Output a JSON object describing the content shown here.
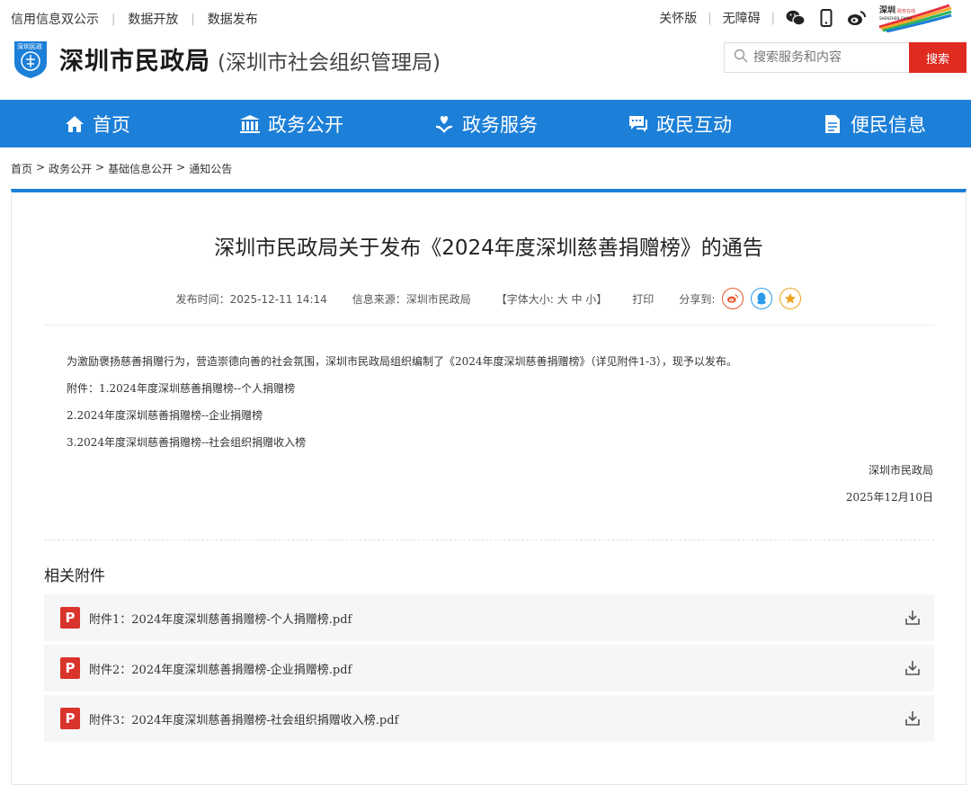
{
  "topbar": {
    "links": [
      "信用信息双公示",
      "数据开放",
      "数据发布"
    ],
    "care_mode": "关怀版",
    "accessibility": "无障碍",
    "city_logo_text": "深圳 SHENZHEN CHINA"
  },
  "header": {
    "emblem_text": "深圳民政",
    "title": "深圳市民政局",
    "subtitle": "(深圳市社会组织管理局)",
    "search_placeholder": "搜索服务和内容",
    "search_button": "搜索"
  },
  "nav": [
    {
      "label": "首页",
      "icon": "home-icon"
    },
    {
      "label": "政务公开",
      "icon": "government-building-icon"
    },
    {
      "label": "政务服务",
      "icon": "service-hand-icon"
    },
    {
      "label": "政民互动",
      "icon": "chat-icon"
    },
    {
      "label": "便民信息",
      "icon": "document-icon"
    }
  ],
  "breadcrumb": [
    "首页",
    "政务公开",
    "基础信息公开",
    "通知公告"
  ],
  "article": {
    "title": "深圳市民政局关于发布《2024年度深圳慈善捐赠榜》的通告",
    "publish_time": "发布时间：2025-12-11 14:14",
    "source": "信息来源：深圳市民政局",
    "font_size": "【字体大小: 大 中 小】",
    "print": "打印",
    "share_label": "分享到:",
    "paragraphs": [
      "为激励褒扬慈善捐赠行为，营造崇德向善的社会氛围，深圳市民政局组织编制了《2024年度深圳慈善捐赠榜》（详见附件1-3），现予以发布。",
      "附件：1.2024年度深圳慈善捐赠榜--个人捐赠榜",
      "2.2024年度深圳慈善捐赠榜--企业捐赠榜",
      "3.2024年度深圳慈善捐赠榜--社会组织捐赠收入榜"
    ],
    "signature": "深圳市民政局",
    "date": "2025年12月10日"
  },
  "attachments": {
    "heading": "相关附件",
    "pdf_label": "P",
    "items": [
      "附件1：2024年度深圳慈善捐赠榜-个人捐赠榜.pdf",
      "附件2：2024年度深圳慈善捐赠榜-企业捐赠榜.pdf",
      "附件3：2024年度深圳慈善捐赠榜-社会组织捐赠收入榜.pdf"
    ]
  },
  "colors": {
    "nav_blue": "#1c7fd8",
    "search_red": "#e02b20",
    "pdf_red": "#d9342b",
    "weibo": "#e8552c",
    "qq": "#2b9be8",
    "qzone": "#f0a020"
  }
}
